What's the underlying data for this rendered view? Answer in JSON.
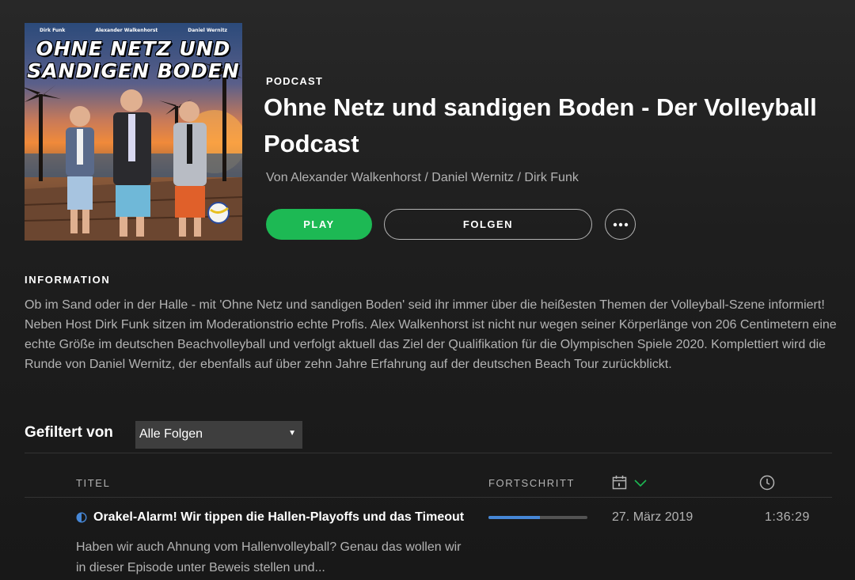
{
  "podcast": {
    "type_label": "PODCAST",
    "title": "Ohne Netz und sandigen Boden - Der Volleyball Podcast",
    "author": "Von Alexander Walkenhorst / Daniel Wernitz / Dirk Funk",
    "cover": {
      "title_line1": "OHNE NETZ UND",
      "title_line2": "SANDIGEN BODEN",
      "names": [
        "Dirk Funk",
        "Alexander Walkenhorst",
        "Daniel Wernitz"
      ]
    }
  },
  "actions": {
    "play_label": "PLAY",
    "follow_label": "FOLGEN",
    "more_icon": "more-horizontal-icon"
  },
  "information": {
    "heading": "INFORMATION",
    "text": "Ob im Sand oder in der Halle - mit 'Ohne Netz und sandigen Boden' seid ihr immer über die heißesten Themen der Volleyball-Szene informiert! Neben Host Dirk Funk sitzen im Moderationstrio echte Profis. Alex Walkenhorst ist nicht nur wegen seiner Körperlänge von 206 Centimetern eine echte Größe im deutschen Beachvolleyball und verfolgt aktuell das Ziel der Qualifikation für die Olympischen Spiele 2020. Komplettiert wird die Runde von Daniel Wernitz, der ebenfalls auf über zehn Jahre Erfahrung auf der deutschen Beach Tour zurückblickt."
  },
  "filter": {
    "label": "Gefiltert von",
    "selected": "Alle Folgen"
  },
  "columns": {
    "title": "TITEL",
    "progress": "FORTSCHRITT",
    "date_icon": "calendar-icon",
    "sort_icon": "chevron-down-icon",
    "duration_icon": "clock-icon"
  },
  "episodes": [
    {
      "title": "Orakel-Alarm! Wir tippen die Hallen-Playoffs und das Timeout",
      "description": "Haben wir auch Ahnung vom Hallenvolleyball? Genau das wollen wir in dieser Episode unter Beweis stellen und...",
      "progress": 0.52,
      "date": "27. März 2019",
      "duration": "1:36:29",
      "status_icon": "half-played-icon"
    }
  ],
  "colors": {
    "accent_green": "#1db954",
    "progress_blue": "#4687d6",
    "text_muted": "#b3b3b3"
  }
}
